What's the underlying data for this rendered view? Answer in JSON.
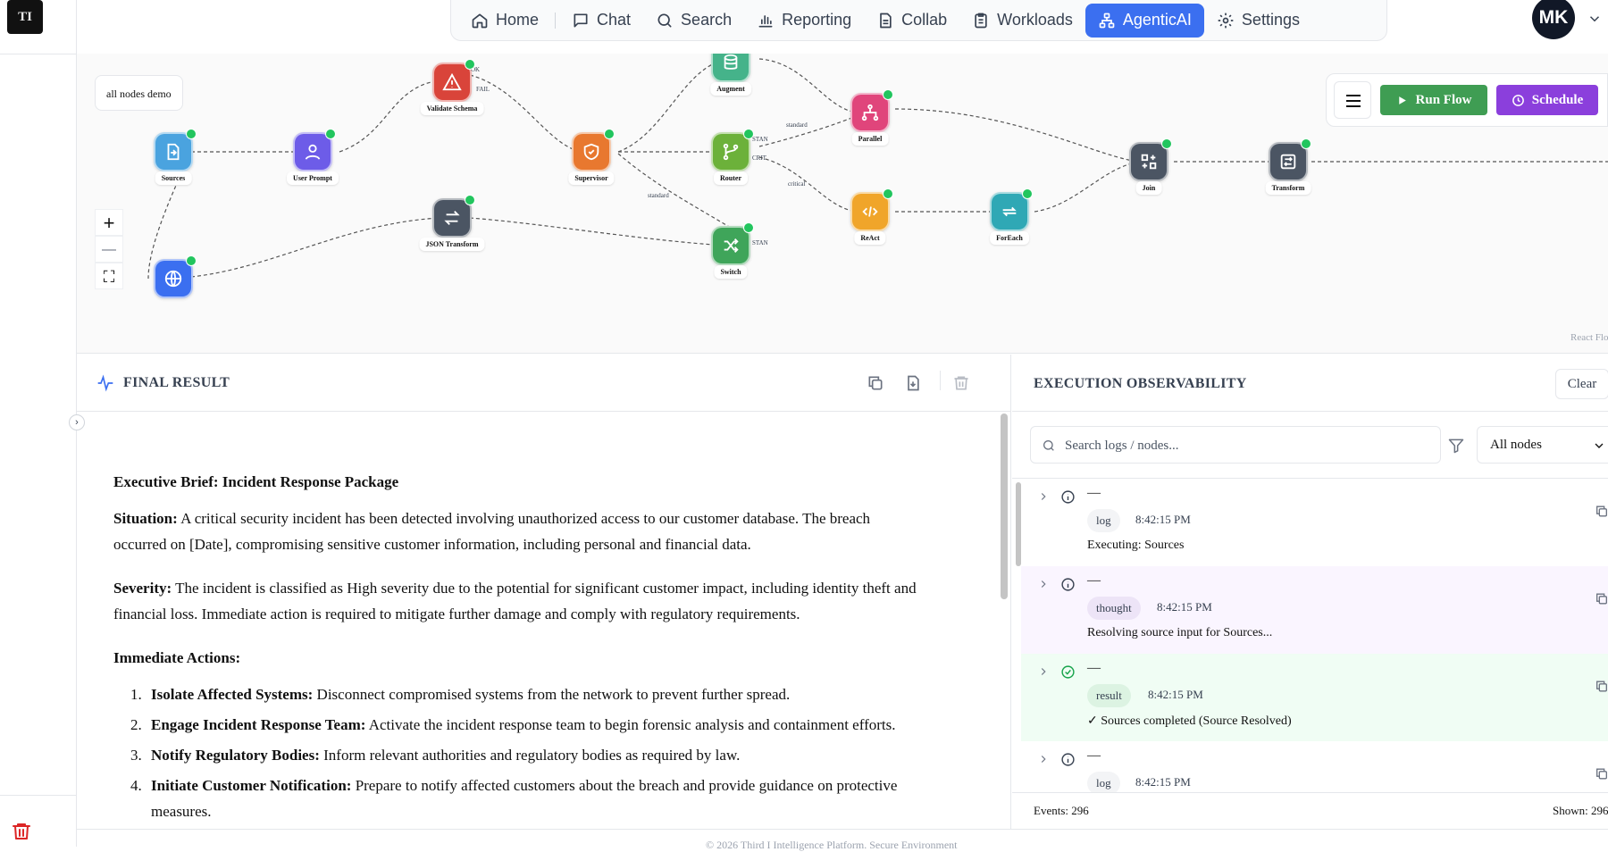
{
  "app": {
    "logo_text": "TI"
  },
  "nav": {
    "items": [
      {
        "key": "home",
        "label": "Home",
        "icon": "home-icon",
        "active": false
      },
      {
        "key": "chat",
        "label": "Chat",
        "icon": "chat-icon",
        "active": false
      },
      {
        "key": "search",
        "label": "Search",
        "icon": "search-icon",
        "active": false
      },
      {
        "key": "reporting",
        "label": "Reporting",
        "icon": "bar-chart-icon",
        "active": false
      },
      {
        "key": "collab",
        "label": "Collab",
        "icon": "document-icon",
        "active": false
      },
      {
        "key": "workloads",
        "label": "Workloads",
        "icon": "clipboard-icon",
        "active": false
      },
      {
        "key": "agenticai",
        "label": "AgenticAI",
        "icon": "network-icon",
        "active": true
      },
      {
        "key": "settings",
        "label": "Settings",
        "icon": "gear-icon",
        "active": false
      }
    ],
    "avatar_initials": "MK",
    "active_color": "#3b6ff0"
  },
  "canvas": {
    "flow_name": "all nodes demo",
    "zoom_in": "+",
    "zoom_out": "—",
    "fit_view": "⛶",
    "run_label": "Run Flow",
    "schedule_label": "Schedule",
    "run_color": "#3f9d53",
    "schedule_color": "#8b3fdc",
    "attribution": "React Flow",
    "nodes": [
      {
        "key": "sources",
        "label": "Sources",
        "color": "#4aa3df",
        "icon": "file-import-icon"
      },
      {
        "key": "user-prompt",
        "label": "User Prompt",
        "color": "#6d5ce8",
        "icon": "user-icon"
      },
      {
        "key": "validate-schema",
        "label": "Validate Schema",
        "color": "#d9443a",
        "icon": "warning-icon"
      },
      {
        "key": "supervisor",
        "label": "Supervisor",
        "color": "#e8782f",
        "icon": "shield-icon"
      },
      {
        "key": "augment",
        "label": "Augment",
        "color": "#45b38a",
        "icon": "database-icon"
      },
      {
        "key": "router",
        "label": "Router",
        "color": "#6cb13a",
        "icon": "branch-icon"
      },
      {
        "key": "parallel",
        "label": "Parallel",
        "color": "#e0457b",
        "icon": "hierarchy-icon"
      },
      {
        "key": "react",
        "label": "ReAct",
        "color": "#f0a52a",
        "icon": "code-icon"
      },
      {
        "key": "foreach",
        "label": "ForEach",
        "color": "#2fa8b5",
        "icon": "repeat-icon"
      },
      {
        "key": "join",
        "label": "Join",
        "color": "#4b5563",
        "icon": "join-icon"
      },
      {
        "key": "transform",
        "label": "Transform",
        "color": "#4b5563",
        "icon": "transform-icon"
      },
      {
        "key": "json-transform",
        "label": "JSON Transform",
        "color": "#4b5563",
        "icon": "swap-icon"
      },
      {
        "key": "switch",
        "label": "Switch",
        "color": "#3fa55a",
        "icon": "shuffle-icon"
      },
      {
        "key": "web",
        "label": "",
        "color": "#3b6ff0",
        "icon": "globe-icon"
      }
    ],
    "edge_labels": [
      "OK",
      "FAIL",
      "standard",
      "STAN",
      "CRIT",
      "critical",
      "standard",
      "STAN"
    ]
  },
  "result": {
    "header": "FINAL RESULT",
    "title": "Executive Brief: Incident Response Package",
    "situation_label": "Situation:",
    "situation_text": " A critical security incident has been detected involving unauthorized access to our customer database. The breach occurred on [Date], compromising sensitive customer information, including personal and financial data.",
    "severity_label": "Severity:",
    "severity_text": " The incident is classified as High severity due to the potential for significant customer impact, including identity theft and financial loss. Immediate action is required to mitigate further damage and comply with regulatory requirements.",
    "actions_heading": "Immediate Actions:",
    "actions": [
      {
        "label": "Isolate Affected Systems:",
        "text": " Disconnect compromised systems from the network to prevent further spread."
      },
      {
        "label": "Engage Incident Response Team:",
        "text": " Activate the incident response team to begin forensic analysis and containment efforts."
      },
      {
        "label": "Notify Regulatory Bodies:",
        "text": " Inform relevant authorities and regulatory bodies as required by law."
      },
      {
        "label": "Initiate Customer Notification:",
        "text": " Prepare to notify affected customers about the breach and provide guidance on protective measures."
      }
    ]
  },
  "observability": {
    "header": "EXECUTION OBSERVABILITY",
    "clear_label": "Clear",
    "search_placeholder": "Search logs / nodes...",
    "node_filter_value": "All nodes",
    "entries": [
      {
        "status": "info",
        "title": "—",
        "badge": "log",
        "time": "8:42:15 PM",
        "message": "Executing: Sources",
        "bg": "#ffffff",
        "badge_bg": "#f3f4f6"
      },
      {
        "status": "info",
        "title": "—",
        "badge": "thought",
        "time": "8:42:15 PM",
        "message": "Resolving source input for Sources...",
        "bg": "#faf5ff",
        "badge_bg": "#ede4f7"
      },
      {
        "status": "success",
        "title": "—",
        "badge": "result",
        "time": "8:42:15 PM",
        "message": "✓ Sources completed (Source Resolved)",
        "bg": "#f0fdf4",
        "badge_bg": "#dcf3e2"
      },
      {
        "status": "info",
        "title": "—",
        "badge": "log",
        "time": "8:42:15 PM",
        "message": "",
        "bg": "#ffffff",
        "badge_bg": "#f3f4f6"
      }
    ],
    "events_label": "Events: 296",
    "shown_label": "Shown: 296"
  },
  "footer": {
    "text": "© 2026 Third I Intelligence Platform. Secure Environment"
  }
}
